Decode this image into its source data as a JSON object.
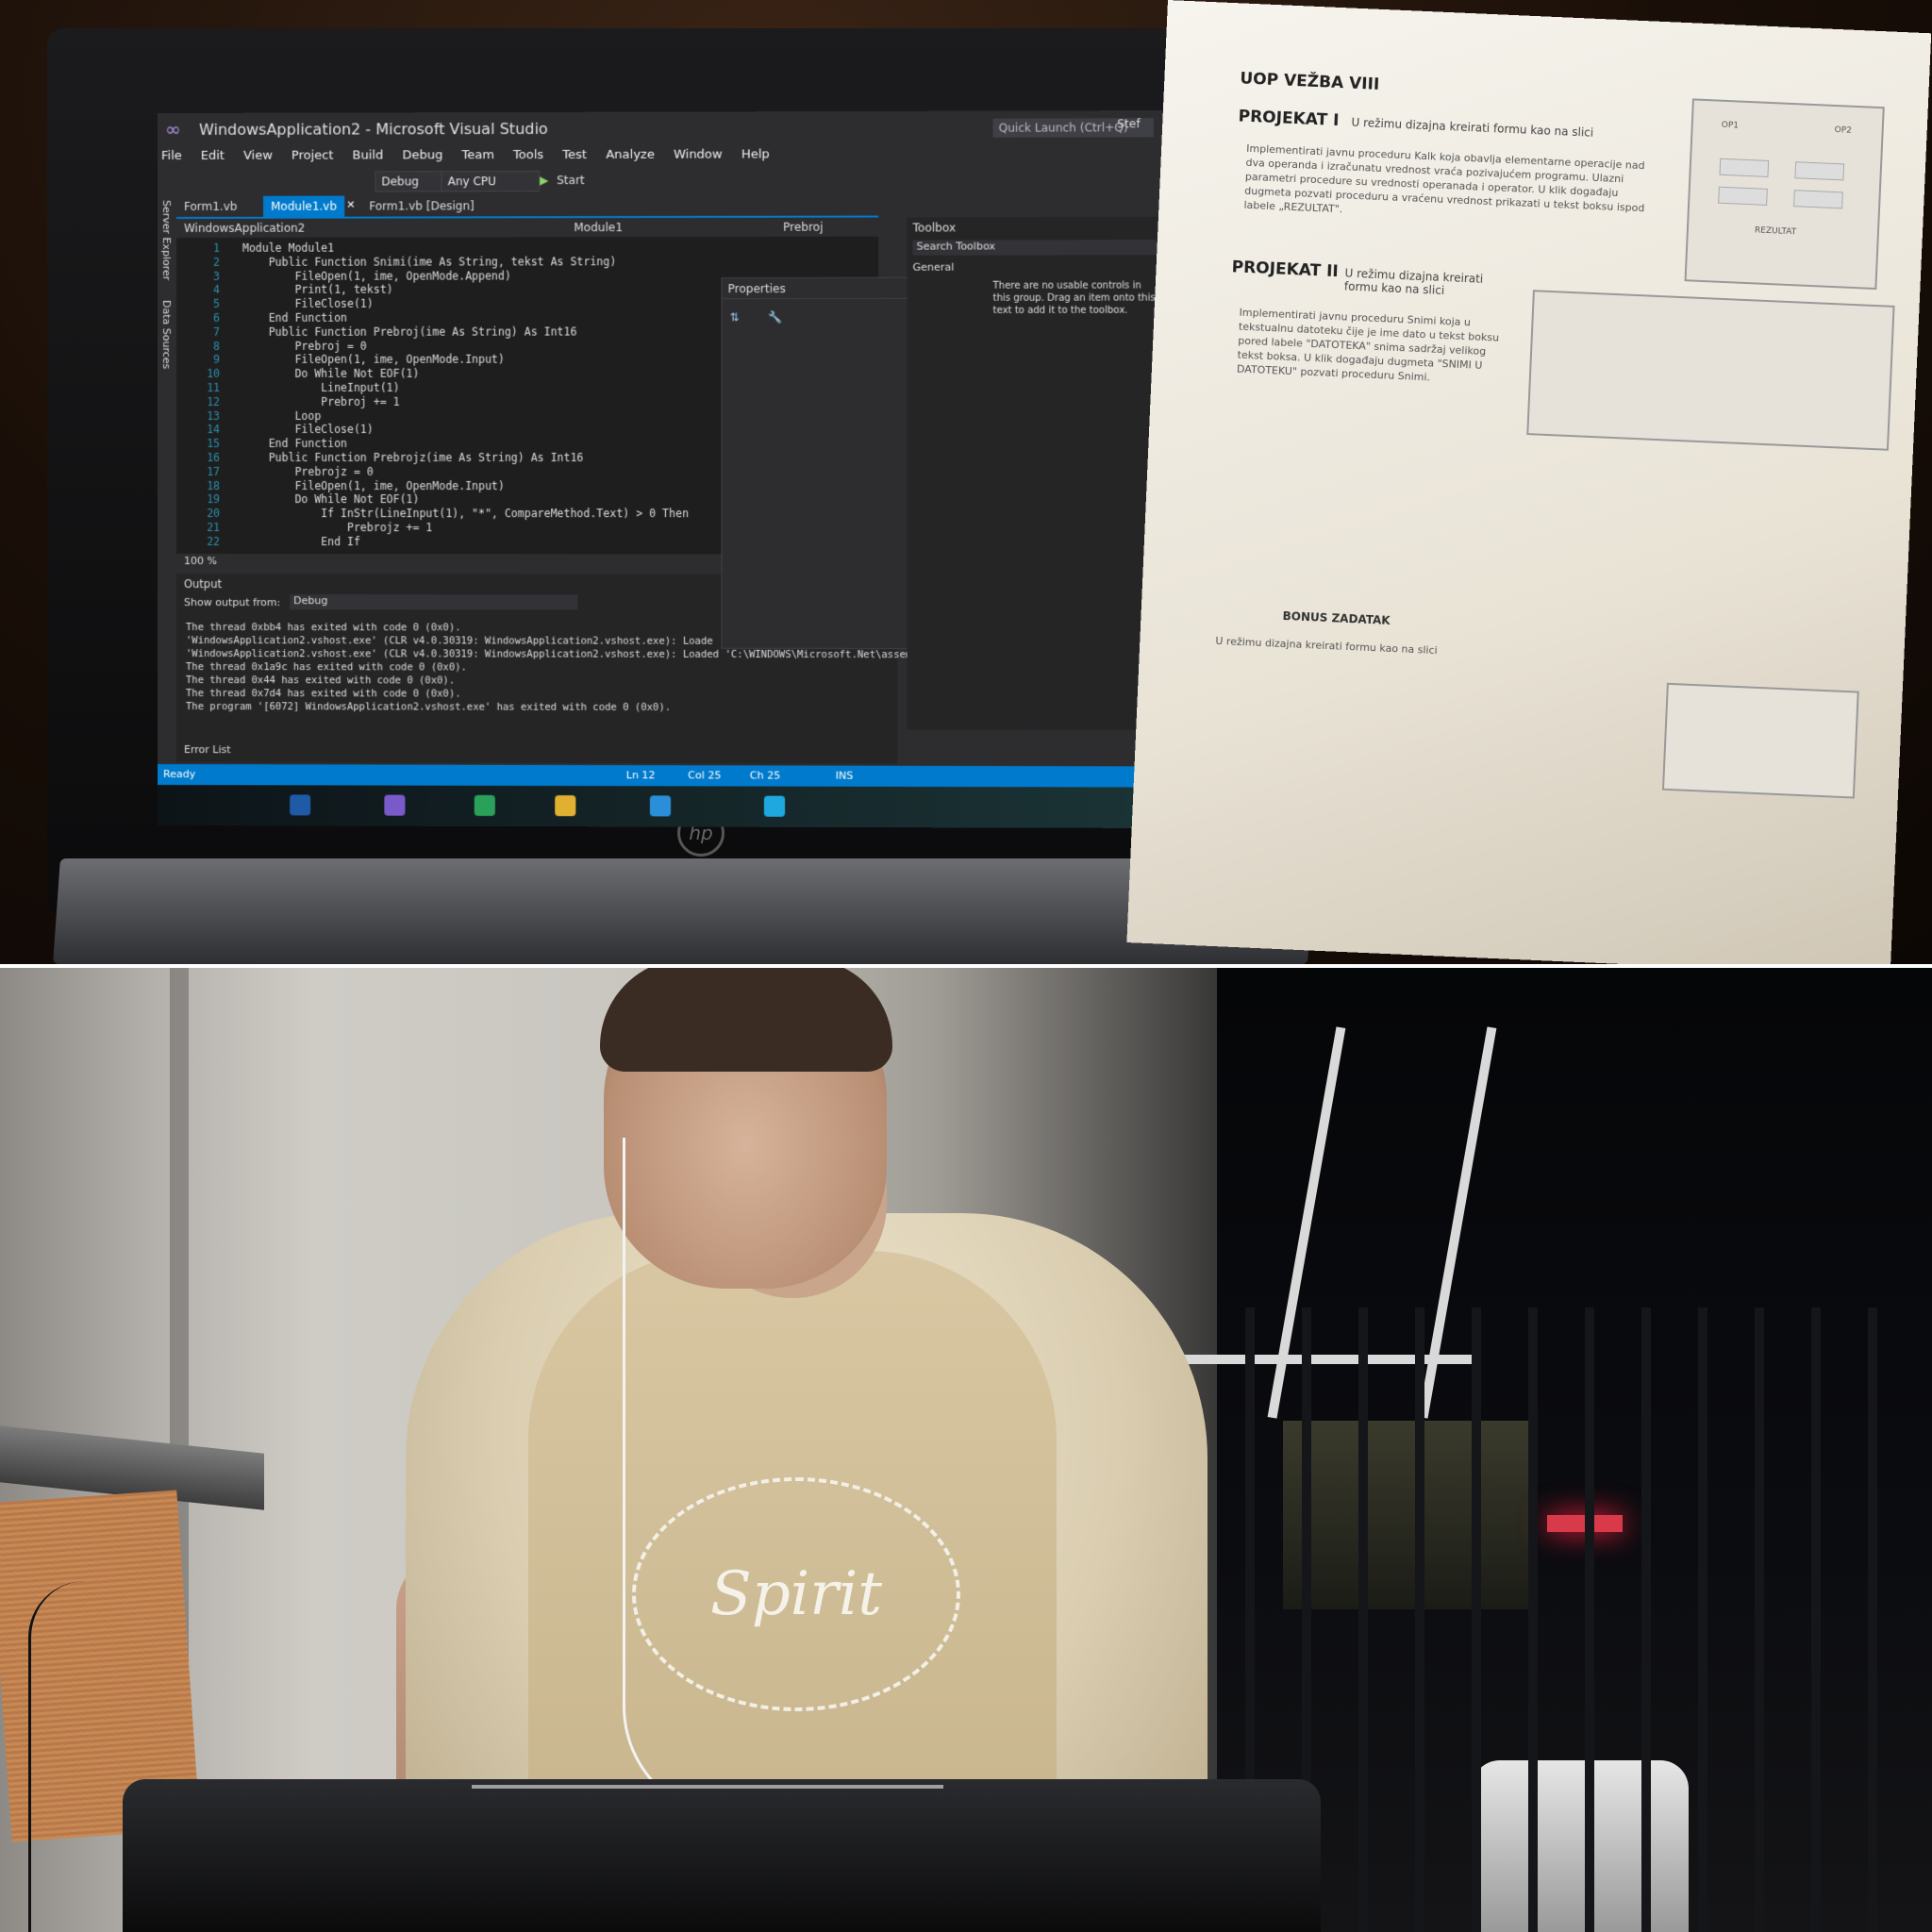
{
  "top_photo": {
    "screen": {
      "window_title": "WindowsApplication2 - Microsoft Visual Studio",
      "quick_launch_placeholder": "Quick Launch (Ctrl+Q)",
      "menu": [
        "File",
        "Edit",
        "View",
        "Project",
        "Build",
        "Debug",
        "Team",
        "Tools",
        "Test",
        "Analyze",
        "Window",
        "Help"
      ],
      "toolbar": {
        "config": "Debug",
        "platform": "Any CPU",
        "start": "Start"
      },
      "tabs": [
        "Form1.vb",
        "Module1.vb",
        "Form1.vb [Design]"
      ],
      "side_panels": [
        "Server Explorer",
        "Data Sources"
      ],
      "nav": {
        "project": "WindowsApplication2",
        "module": "Module1",
        "member": "Prebroj"
      },
      "code_lines": [
        {
          "n": "1",
          "t": "Module Module1"
        },
        {
          "n": "2",
          "t": "    Public Function Snimi(ime As String, tekst As String)"
        },
        {
          "n": "3",
          "t": "        FileOpen(1, ime, OpenMode.Append)"
        },
        {
          "n": "4",
          "t": "        Print(1, tekst)"
        },
        {
          "n": "5",
          "t": "        FileClose(1)"
        },
        {
          "n": "6",
          "t": "    End Function"
        },
        {
          "n": "7",
          "t": "    Public Function Prebroj(ime As String) As Int16"
        },
        {
          "n": "8",
          "t": "        Prebroj = 0"
        },
        {
          "n": "9",
          "t": "        FileOpen(1, ime, OpenMode.Input)"
        },
        {
          "n": "10",
          "t": "        Do While Not EOF(1)"
        },
        {
          "n": "11",
          "t": "            LineInput(1)"
        },
        {
          "n": "12",
          "t": "            Prebroj += 1"
        },
        {
          "n": "13",
          "t": "        Loop"
        },
        {
          "n": "14",
          "t": "        FileClose(1)"
        },
        {
          "n": "15",
          "t": "    End Function"
        },
        {
          "n": "16",
          "t": "    Public Function Prebrojz(ime As String) As Int16"
        },
        {
          "n": "17",
          "t": "        Prebrojz = 0"
        },
        {
          "n": "18",
          "t": "        FileOpen(1, ime, OpenMode.Input)"
        },
        {
          "n": "19",
          "t": "        Do While Not EOF(1)"
        },
        {
          "n": "20",
          "t": "            If InStr(LineInput(1), \"*\", CompareMethod.Text) > 0 Then"
        },
        {
          "n": "21",
          "t": "                Prebrojz += 1"
        },
        {
          "n": "22",
          "t": "            End If"
        }
      ],
      "zoom": "100 %",
      "output": {
        "title": "Output",
        "show_from_label": "Show output from:",
        "show_from_value": "Debug",
        "lines": [
          "The thread 0xbb4 has exited with code 0 (0x0).",
          "'WindowsApplication2.vshost.exe' (CLR v4.0.30319: WindowsApplication2.vshost.exe): Loade",
          "'WindowsApplication2.vshost.exe' (CLR v4.0.30319: WindowsApplication2.vshost.exe): Loaded 'C:\\WINDOWS\\Microsoft.Net\\assembly\\G",
          "The thread 0x1a9c has exited with code 0 (0x0).",
          "The thread 0x44 has exited with code 0 (0x0).",
          "The thread 0x7d4 has exited with code 0 (0x0).",
          "The program '[6072] WindowsApplication2.vshost.exe' has exited with code 0 (0x0)."
        ]
      },
      "error_list": "Error List",
      "properties_title": "Properties",
      "toolbox": {
        "title": "Toolbox",
        "search": "Search Toolbox",
        "group": "General",
        "hint": "There are no usable controls in this group. Drag an item onto this text to add it to the toolbox."
      },
      "status": {
        "ready": "Ready",
        "ln": "Ln 12",
        "col": "Col 25",
        "ch": "Ch 25",
        "ins": "INS"
      },
      "user": "Stef"
    },
    "paper": {
      "title": "UOP VEŽBA VIII",
      "p1_head": "PROJEKAT I",
      "p1_intro": "U režimu dizajna kreirati formu kao na slici",
      "p1_text": "Implementirati javnu proceduru Kalk koja obavlja elementarne operacije nad dva operanda i izračunatu vrednost vraća pozivajućem programu. Ulazni parametri procedure su vrednosti operanada i operator. U klik događaju dugmeta pozvati proceduru a vraćenu vrednost prikazati u tekst boksu ispod labele „REZULTAT\".",
      "p2_head": "PROJEKAT II",
      "p2_intro": "U režimu dizajna kreirati formu kao na slici",
      "p2_text": "Implementirati javnu proceduru Snimi koja u tekstualnu datoteku čije je ime dato u tekst boksu pored labele \"DATOTEKA\" snima sadržaj velikog tekst boksa. U klik događaju dugmeta \"SNIMI U DATOTEKU\" pozvati proceduru Snimi.",
      "bonus": "BONUS ZADATAK",
      "bonus_intro": "U režimu dizajna kreirati formu kao na slici",
      "sketch_labels": [
        "OP1",
        "OP2",
        "REZULTAT"
      ]
    }
  },
  "bottom_photo": {
    "shirt_print": "Spirit"
  }
}
